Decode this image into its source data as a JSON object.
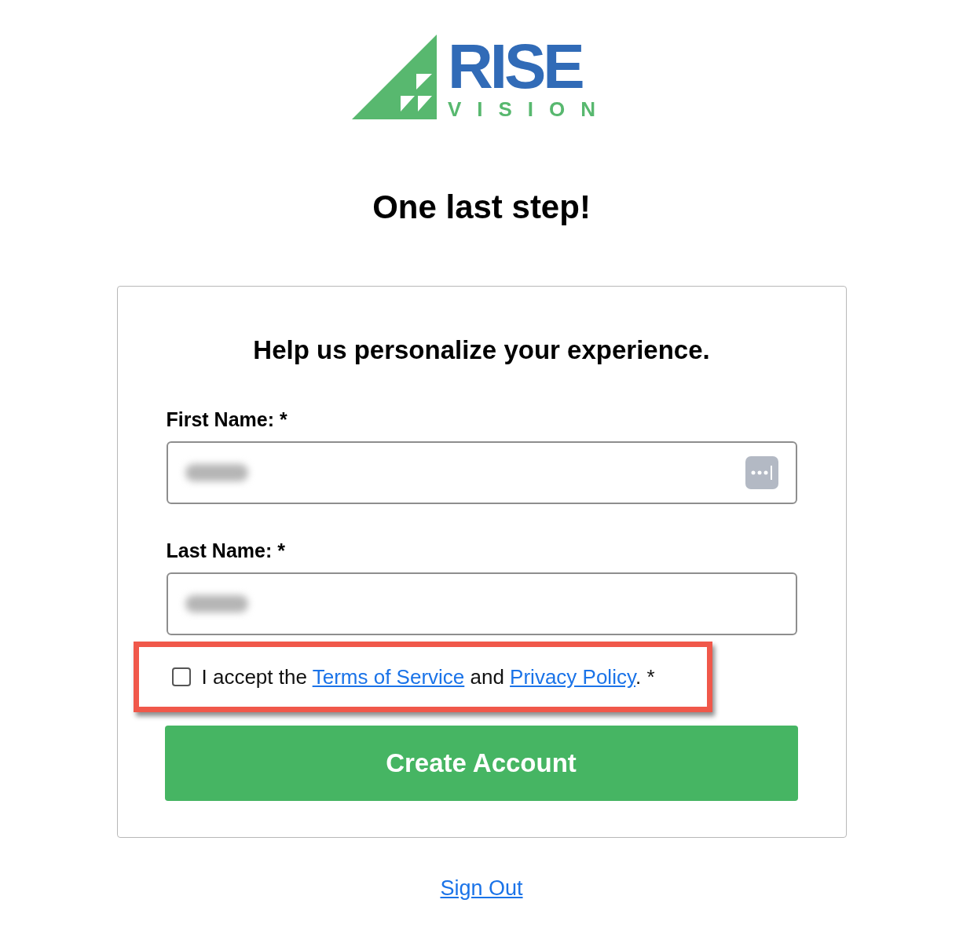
{
  "logo": {
    "word": "RISE",
    "subword": "VISION"
  },
  "title": "One last step!",
  "form": {
    "heading": "Help us personalize your experience.",
    "fields": [
      {
        "label": "First Name: *",
        "autofill_icon": true
      },
      {
        "label": "Last Name: *",
        "autofill_icon": false
      }
    ],
    "consent": {
      "checked": false,
      "highlighted": true,
      "segments": [
        {
          "kind": "text",
          "text": "I accept the "
        },
        {
          "kind": "link",
          "text": "Terms of Service"
        },
        {
          "kind": "text",
          "text": " and "
        },
        {
          "kind": "link",
          "text": "Privacy Policy"
        },
        {
          "kind": "text",
          "text": ". *"
        }
      ]
    },
    "submit": "Create Account"
  },
  "sign_out": "Sign Out"
}
